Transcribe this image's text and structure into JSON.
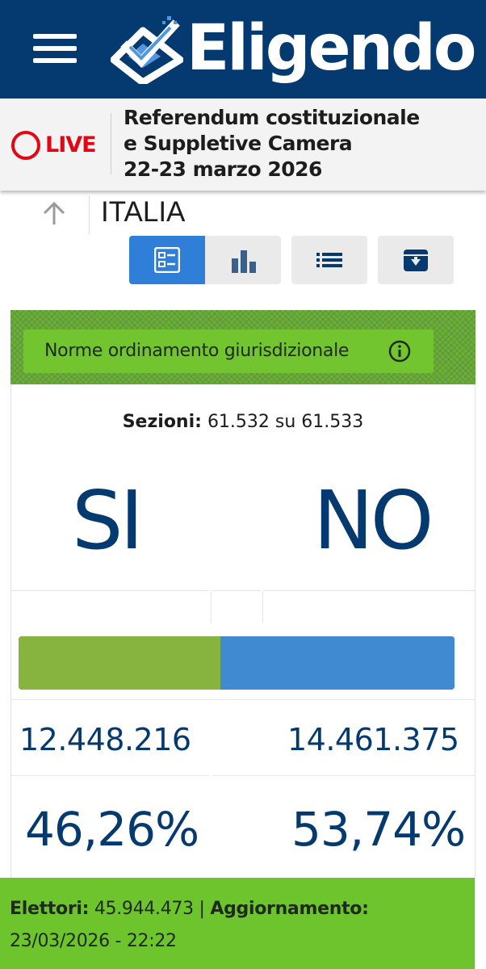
{
  "header": {
    "brand": "Eligendo",
    "menu_icon": "hamburger-menu-icon",
    "logo_icon": "ballot-check-logo-icon",
    "background_color": "#053a70"
  },
  "live": {
    "badge": "LIVE",
    "badge_color": "#e30613",
    "title_lines": [
      "Referendum costituzionale",
      "e Suppletive Camera",
      "22-23 marzo 2026"
    ]
  },
  "breadcrumb": {
    "up_icon": "arrow-up-icon",
    "label": "ITALIA"
  },
  "view_buttons": [
    {
      "name": "results-card-view",
      "icon": "list-card-icon",
      "active": true
    },
    {
      "name": "chart-view",
      "icon": "bar-chart-icon",
      "active": false
    },
    {
      "name": "list-view",
      "icon": "list-icon",
      "active": false
    },
    {
      "name": "archive-view",
      "icon": "archive-download-icon",
      "active": false
    }
  ],
  "question": {
    "label": "Norme ordinamento giurisdizionale",
    "info_icon": "info-icon",
    "color": "#72c52e"
  },
  "sections": {
    "label": "Sezioni:",
    "value": "61.532 su 61.533"
  },
  "results": {
    "si": {
      "label": "SI",
      "votes": "12.448.216",
      "percent": "46,26%",
      "share": 0.4626,
      "color": "#86b43e"
    },
    "no": {
      "label": "NO",
      "votes": "14.461.375",
      "percent": "53,74%",
      "share": 0.5374,
      "color": "#3f8ad1"
    }
  },
  "footer": {
    "electors_label": "Elettori:",
    "electors_value": "45.944.473",
    "separator": "|",
    "update_label": "Aggiornamento:",
    "update_value": "23/03/2026 - 22:22"
  }
}
